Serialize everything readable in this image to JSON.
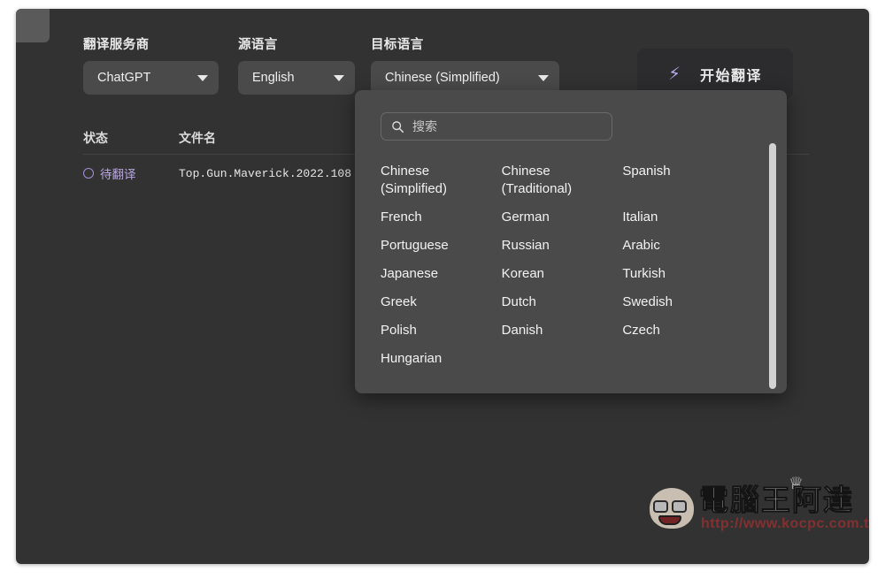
{
  "window": {
    "background": "#323232",
    "panel_background": "#4a4a4a",
    "accent": "#b9a7e0"
  },
  "toolbar": {
    "provider": {
      "label": "翻译服务商",
      "value": "ChatGPT",
      "caret_icon": "chevron-down-icon"
    },
    "source_language": {
      "label": "源语言",
      "value": "English",
      "caret_icon": "chevron-down-icon"
    },
    "target_language": {
      "label": "目标语言",
      "value": "Chinese (Simplified)",
      "caret_icon": "chevron-down-icon"
    },
    "start_button": {
      "label": "开始翻译",
      "icon": "lightning-bolt-icon",
      "icon_glyph": "⚡",
      "icon_color": "#b6a8e8"
    }
  },
  "file_table": {
    "columns": {
      "status": "状态",
      "filename": "文件名"
    },
    "rows": [
      {
        "status": "待翻译",
        "status_icon": "circle-outline-icon",
        "status_color": "#b9a7e0",
        "filename": "Top.Gun.Maverick.2022.108"
      }
    ]
  },
  "language_dropdown": {
    "search": {
      "placeholder": "搜索",
      "value": "",
      "icon": "search-icon"
    },
    "options": [
      "Chinese (Simplified)",
      "Chinese (Traditional)",
      "Spanish",
      "French",
      "German",
      "Italian",
      "Portuguese",
      "Russian",
      "Arabic",
      "Japanese",
      "Korean",
      "Turkish",
      "Greek",
      "Dutch",
      "Swedish",
      "Polish",
      "Danish",
      "Czech",
      "Hungarian"
    ],
    "scrollbar": {
      "name": "vertical-scrollbar"
    }
  },
  "watermark": {
    "title": "電腦王阿達",
    "url": "http://www.kocpc.com.tw",
    "crown_glyph": "♕"
  }
}
